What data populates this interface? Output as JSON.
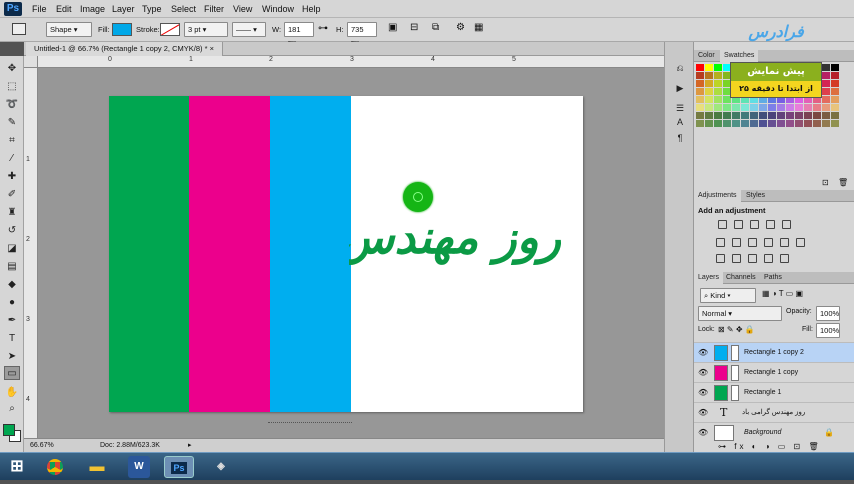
{
  "app": {
    "logo": "Ps"
  },
  "menu": [
    "File",
    "Edit",
    "Image",
    "Layer",
    "Type",
    "Select",
    "Filter",
    "View",
    "Window",
    "Help"
  ],
  "options": {
    "mode": "Shape",
    "fill_label": "Fill:",
    "stroke_label": "Stroke:",
    "stroke_width": "3 pt",
    "w_label": "W:",
    "w_value": "181 px",
    "h_label": "H:",
    "h_value": "735 px",
    "fill_color": "#00a8e8"
  },
  "document": {
    "tab_title": "Untitled-1 @ 66.7% (Rectangle 1 copy 2, CMYK/8) *",
    "zoom": "66.67%",
    "doc_size": "Doc: 2.88M/623.3K",
    "text": "روز مهندس گ",
    "ruler_h": [
      "0",
      "1",
      "2",
      "3",
      "4",
      "5"
    ],
    "ruler_v": [
      "1",
      "2",
      "3",
      "4"
    ],
    "colors": {
      "green": "#00a650",
      "pink": "#ec008c",
      "blue": "#00aeef",
      "text_green": "#0b9a45"
    }
  },
  "brand": {
    "text": "فرادرس"
  },
  "promo": {
    "top": "پیش نمایش",
    "bottom": "از ابتدا تا دقیقه ۲۵"
  },
  "panels": {
    "color_tab": "Color",
    "swatches_tab": "Swatches",
    "adjustments_tab": "Adjustments",
    "styles_tab": "Styles",
    "add_adjustment": "Add an adjustment",
    "layers_tab": "Layers",
    "channels_tab": "Channels",
    "paths_tab": "Paths",
    "kind": "Kind",
    "blend_mode": "Normal",
    "opacity_label": "Opacity:",
    "opacity_value": "100%",
    "lock_label": "Lock:",
    "fill_label": "Fill:",
    "fill_value": "100%"
  },
  "layers": [
    {
      "name": "Rectangle 1 copy 2",
      "color": "#00aeef",
      "selected": true
    },
    {
      "name": "Rectangle 1 copy",
      "color": "#ec008c",
      "selected": false
    },
    {
      "name": "Rectangle 1",
      "color": "#00a650",
      "selected": false
    },
    {
      "name": "روز مهندس گرامی باد",
      "color": "",
      "selected": false
    },
    {
      "name": "Background",
      "color": "#ffffff",
      "selected": false
    }
  ],
  "taskbar": [
    "start-button",
    "chrome-icon",
    "explorer-icon",
    "word-icon",
    "photoshop-icon",
    "misc-app-icon"
  ]
}
